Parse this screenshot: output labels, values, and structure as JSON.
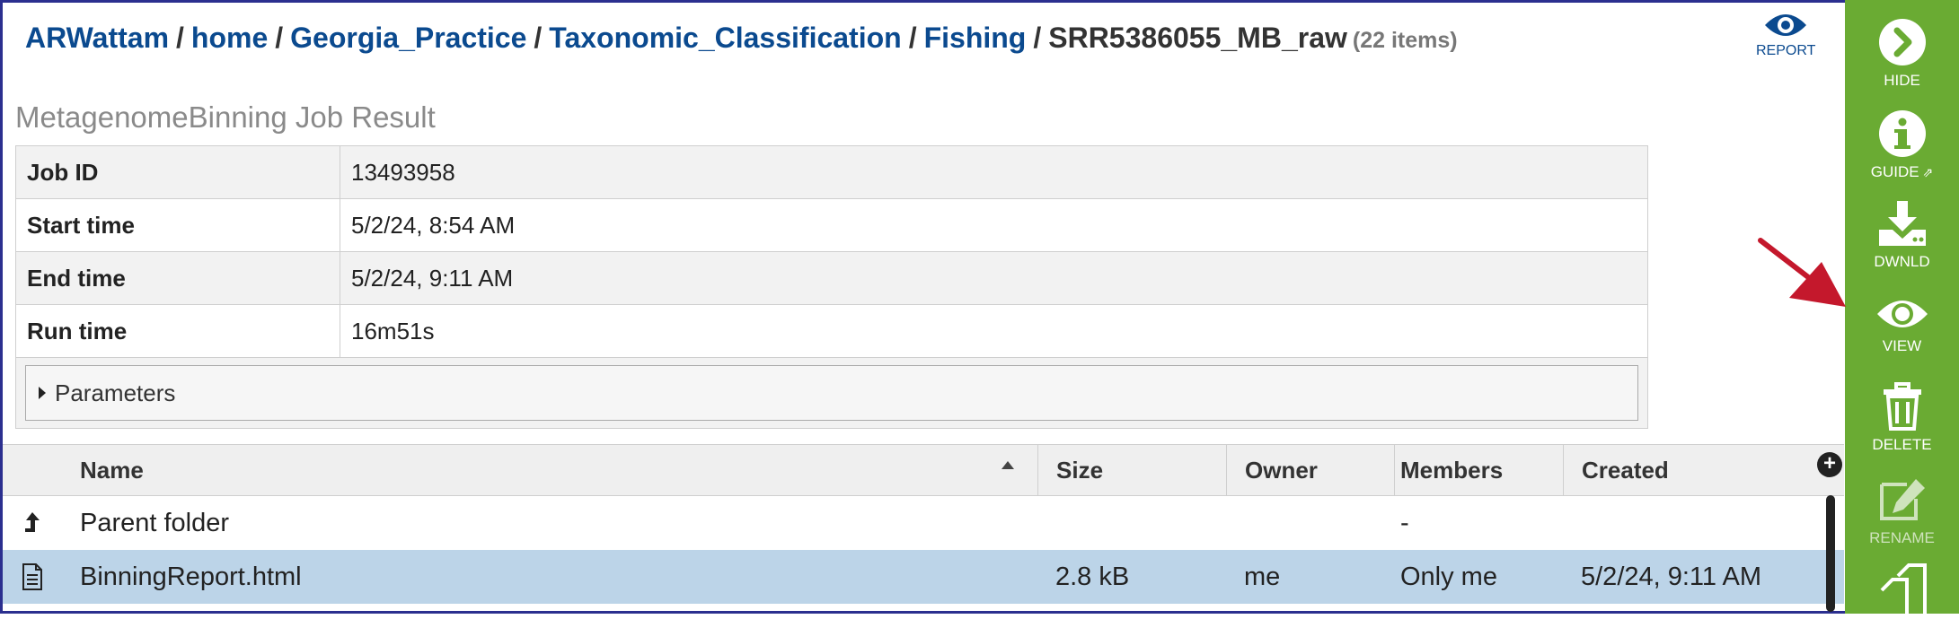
{
  "breadcrumb": {
    "links": [
      "ARWattam",
      "home",
      "Georgia_Practice",
      "Taxonomic_Classification",
      "Fishing"
    ],
    "separator": "/",
    "current": "SRR5386055_MB_raw",
    "item_count": "(22 items)"
  },
  "report_button": {
    "label": "REPORT",
    "icon": "eye-icon"
  },
  "result": {
    "title": "MetagenomeBinning Job Result",
    "rows": [
      {
        "key": "Job ID",
        "value": "13493958"
      },
      {
        "key": "Start time",
        "value": "5/2/24, 8:54 AM"
      },
      {
        "key": "End time",
        "value": "5/2/24, 9:11 AM"
      },
      {
        "key": "Run time",
        "value": "16m51s"
      }
    ],
    "parameters_label": "Parameters"
  },
  "file_grid": {
    "columns": [
      "Name",
      "Size",
      "Owner",
      "Members",
      "Created"
    ],
    "add_column_icon": "plus-circle-icon",
    "rows": [
      {
        "icon": "parent-folder-icon",
        "name": "Parent folder",
        "size": "",
        "owner": "",
        "members": "-",
        "created": "",
        "selected": false
      },
      {
        "icon": "document-icon",
        "name": "BinningReport.html",
        "size": "2.8 kB",
        "owner": "me",
        "members": "Only me",
        "created": "5/2/24, 9:11 AM",
        "selected": true
      }
    ]
  },
  "sidebar": {
    "color": "#6aab33",
    "items": [
      {
        "label": "HIDE",
        "icon": "chevron-right-circle-icon"
      },
      {
        "label": "GUIDE",
        "icon": "info-icon"
      },
      {
        "label": "DWNLD",
        "icon": "download-icon"
      },
      {
        "label": "VIEW",
        "icon": "eye-icon"
      },
      {
        "label": "DELETE",
        "icon": "trash-icon"
      },
      {
        "label": "RENAME",
        "icon": "pencil-icon"
      },
      {
        "label": "",
        "icon": "copy-icon"
      }
    ]
  },
  "annotation": {
    "color": "#c4182c"
  }
}
